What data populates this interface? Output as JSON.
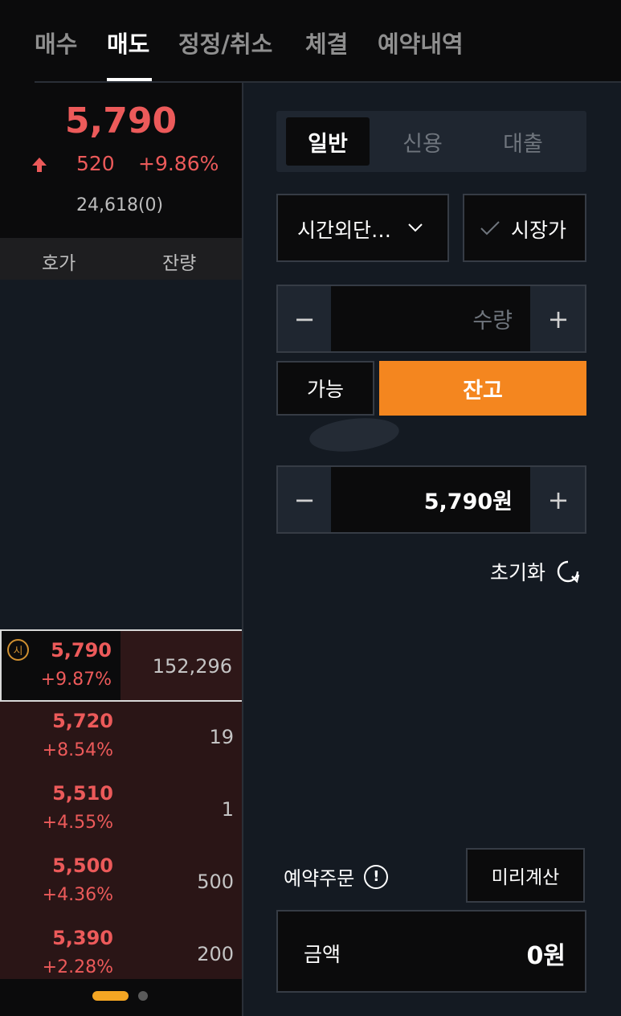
{
  "tabs": [
    {
      "label": "매수",
      "active": false
    },
    {
      "label": "매도",
      "active": true
    },
    {
      "label": "정정/취소",
      "active": false
    },
    {
      "label": "체결",
      "active": false
    },
    {
      "label": "예약내역",
      "active": false
    }
  ],
  "quote": {
    "price": "5,790",
    "change": "520",
    "change_rate": "+9.86%",
    "volume": "24,618(0)",
    "direction_icon": "up-arrow-icon"
  },
  "orderbook": {
    "headers": {
      "price": "호가",
      "qty": "잔량"
    },
    "rows": [
      {
        "price": "5,790",
        "rate": "+9.87%",
        "qty": "152,296",
        "badge": "시",
        "current": true
      },
      {
        "price": "5,720",
        "rate": "+8.54%",
        "qty": "19"
      },
      {
        "price": "5,510",
        "rate": "+4.55%",
        "qty": "1"
      },
      {
        "price": "5,500",
        "rate": "+4.36%",
        "qty": "500"
      },
      {
        "price": "5,390",
        "rate": "+2.28%",
        "qty": "200"
      }
    ]
  },
  "order": {
    "segments": [
      {
        "label": "일반",
        "active": true
      },
      {
        "label": "신용",
        "active": false
      },
      {
        "label": "대출",
        "active": false
      }
    ],
    "order_type": "시간외단…",
    "market_label": "시장가",
    "qty_placeholder": "수량",
    "avail_label": "가능",
    "balance_label": "잔고",
    "price_value": "5,790원",
    "minus_symbol": "−",
    "plus_symbol": "+",
    "reset_label": "초기화",
    "reserve_label": "예약주문",
    "info_symbol": "!",
    "precalc_label": "미리계산",
    "amount_label": "금액",
    "amount_value": "0원"
  },
  "colors": {
    "up": "#ec5a5a",
    "accent": "#f4861f",
    "pager_active": "#f5a623"
  }
}
